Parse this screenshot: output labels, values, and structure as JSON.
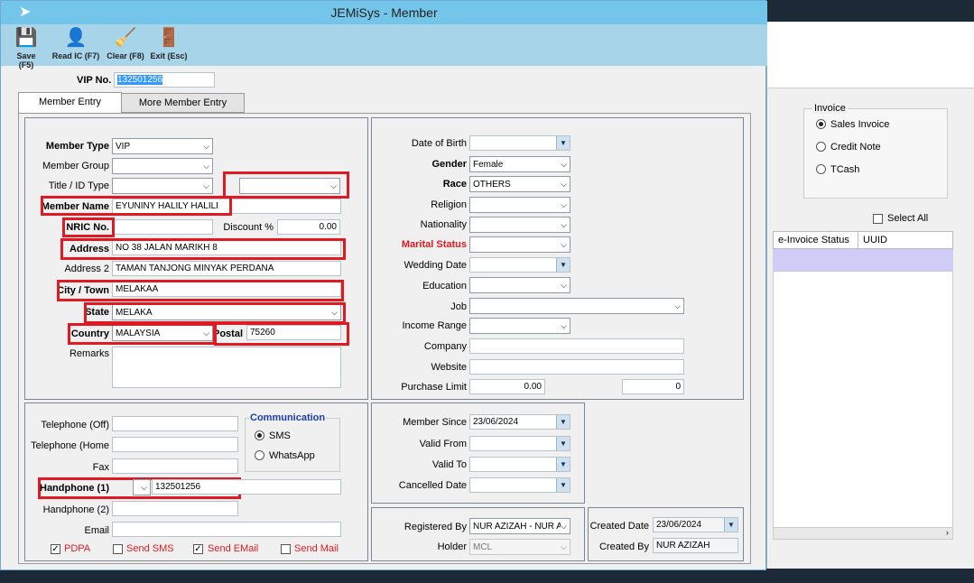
{
  "window": {
    "title": "JEMiSys - Member"
  },
  "toolbar": {
    "save": "Save (F5)",
    "read_ic": "Read IC (F7)",
    "clear": "Clear (F8)",
    "exit": "Exit (Esc)"
  },
  "vip": {
    "label": "VIP No.",
    "value": "132501256"
  },
  "tabs": {
    "member_entry": "Member Entry",
    "more_member_entry": "More Member Entry"
  },
  "left": {
    "member_type_label": "Member Type",
    "member_type": "VIP",
    "member_group_label": "Member Group",
    "member_group": "",
    "title_id_label": "Title / ID Type",
    "title_id": "",
    "id_type": "",
    "member_name_label": "Member Name",
    "member_name": "EYUNINY HALILY HALILI",
    "nric_label": "NRIC No.",
    "nric": "",
    "discount_label": "Discount %",
    "discount": "0.00",
    "address_label": "Address",
    "address": "NO 38 JALAN MARIKH 8",
    "address2_label": "Address 2",
    "address2": "TAMAN TANJONG MINYAK PERDANA",
    "city_label": "City / Town",
    "city": "MELAKAA",
    "state_label": "State",
    "state": "MELAKA",
    "country_label": "Country",
    "country": "MALAYSIA",
    "postal_label": "Postal",
    "postal": "75260",
    "remarks_label": "Remarks"
  },
  "right": {
    "dob_label": "Date of Birth",
    "gender_label": "Gender",
    "gender": "Female",
    "race_label": "Race",
    "race": "OTHERS",
    "religion_label": "Religion",
    "nationality_label": "Nationality",
    "marital_label": "Marital Status",
    "wedding_label": "Wedding Date",
    "education_label": "Education",
    "job_label": "Job",
    "income_label": "Income Range",
    "company_label": "Company",
    "website_label": "Website",
    "purchase_label": "Purchase Limit",
    "purchase_limit": "0.00",
    "purchase_limit2": "0"
  },
  "contact": {
    "tel_off_label": "Telephone (Off)",
    "tel_home_label": "Telephone (Home",
    "fax_label": "Fax",
    "hp1_label": "Handphone (1)",
    "hp1": "132501256",
    "hp2_label": "Handphone (2)",
    "email_label": "Email",
    "comm_title": "Communication",
    "sms": "SMS",
    "whatsapp": "WhatsApp",
    "pdpa": "PDPA",
    "send_sms": "Send SMS",
    "send_email": "Send EMail",
    "send_mail": "Send Mail"
  },
  "membership": {
    "since_label": "Member Since",
    "since": "23/06/2024",
    "valid_from_label": "Valid From",
    "valid_to_label": "Valid To",
    "cancelled_label": "Cancelled Date"
  },
  "registration": {
    "registered_label": "Registered By",
    "registered": "NUR AZIZAH - NUR A",
    "holder_label": "Holder",
    "holder": "MCL",
    "created_date_label": "Created Date",
    "created_date": "23/06/2024",
    "created_by_label": "Created By",
    "created_by": "NUR AZIZAH"
  },
  "background": {
    "invoice_group": "Invoice",
    "sales_invoice": "Sales Invoice",
    "credit_note": "Credit Note",
    "tcash": "TCash",
    "select_all": "Select All",
    "col_einvoice": "e-Invoice Status",
    "col_uuid": "UUID"
  }
}
